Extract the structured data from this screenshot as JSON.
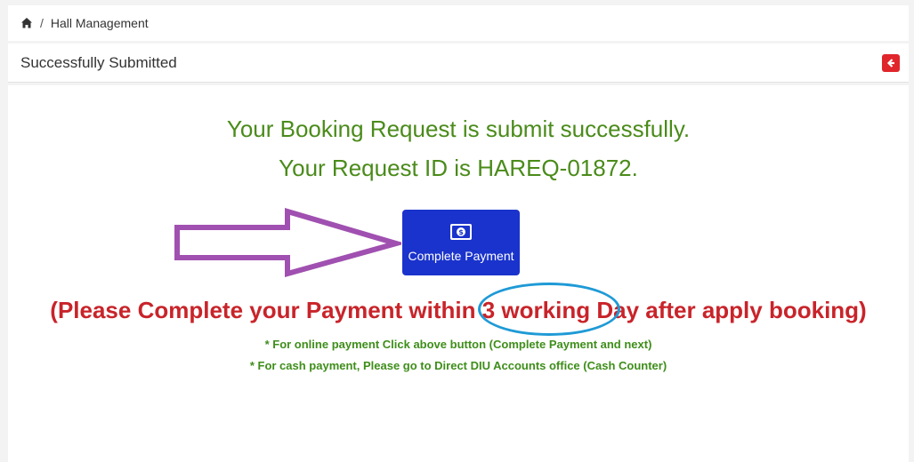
{
  "breadcrumb": {
    "separator": "/",
    "current": "Hall Management"
  },
  "header": {
    "title": "Successfully Submitted"
  },
  "main": {
    "success_line1": "Your Booking Request is submit successfully.",
    "success_line2": "Your Request ID is HAREQ-01872.",
    "pay_button_label": "Complete Payment",
    "warning_pre": "(Please Complete your Payment within ",
    "warning_highlight": "3 working",
    "warning_post": " Day after apply booking)",
    "note_online": "* For online payment Click above button (Complete Payment and next)",
    "note_cash": "* For cash payment, Please go to Direct DIU Accounts office (Cash Counter)"
  },
  "icons": {
    "home": "home-icon",
    "back": "back-arrow-icon",
    "money": "money-bill-icon",
    "annotation_arrow": "right-arrow-annotation"
  },
  "colors": {
    "success_text": "#4a8b1a",
    "warning_text": "#c8242a",
    "button_bg": "#1a33cc",
    "back_button_bg": "#e0262b",
    "annotation_arrow": "#a050b0",
    "annotation_circle": "#1f9ad6"
  }
}
